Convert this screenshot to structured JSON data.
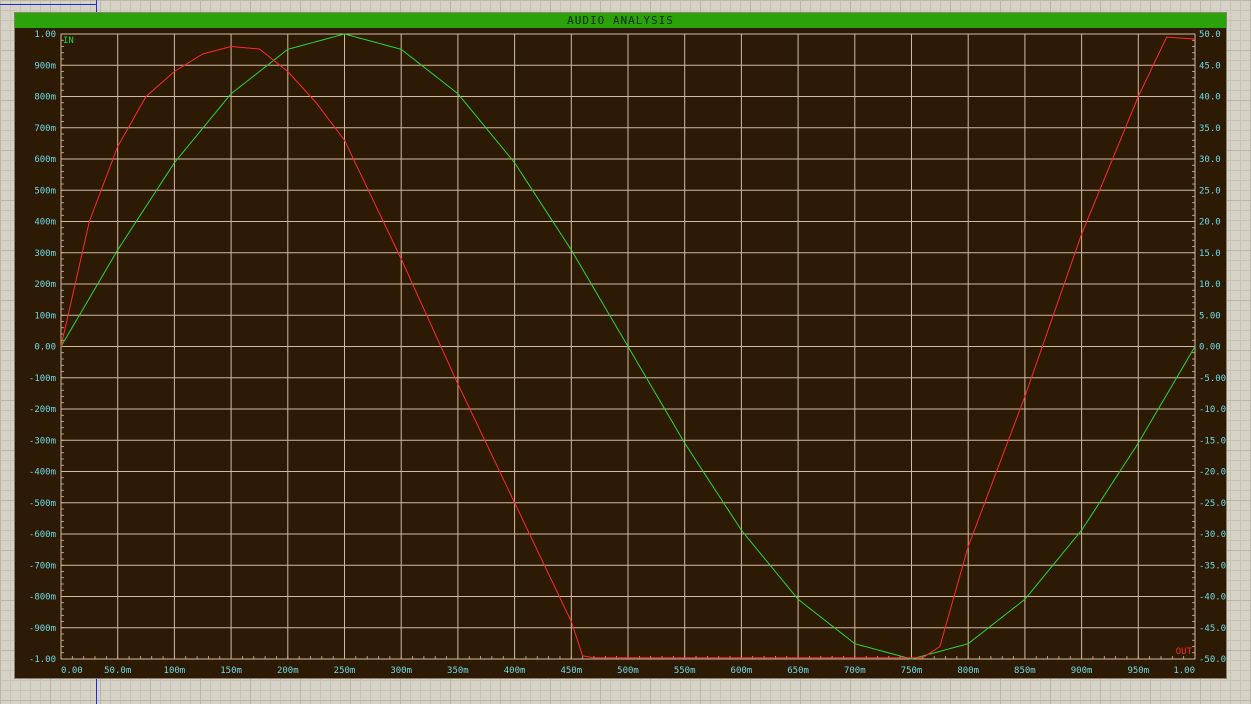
{
  "window": {
    "title": "AUDIO ANALYSIS"
  },
  "colors": {
    "background": "#2d1a04",
    "grid": "#d4b9a2",
    "axis_text": "#6fd9e6",
    "title_bar": "#2aa20a",
    "in_trace": "#2fd62f",
    "out_trace": "#ff2a2a"
  },
  "chart_data": {
    "type": "line",
    "title": "AUDIO ANALYSIS",
    "grid": true,
    "x": [
      0,
      0.05,
      0.1,
      0.15,
      0.2,
      0.25,
      0.3,
      0.35,
      0.4,
      0.45,
      0.5,
      0.55,
      0.6,
      0.65,
      0.7,
      0.75,
      0.8,
      0.85,
      0.9,
      0.95,
      1.0
    ],
    "x_tick_labels": [
      "0.00",
      "50.0m",
      "100m",
      "150m",
      "200m",
      "250m",
      "300m",
      "350m",
      "400m",
      "450m",
      "500m",
      "550m",
      "600m",
      "650m",
      "700m",
      "750m",
      "800m",
      "850m",
      "900m",
      "950m",
      "1.00"
    ],
    "xlim": [
      0,
      1.0
    ],
    "y_left": {
      "range": [
        -1.0,
        1.0
      ],
      "tick_labels": [
        "1.00",
        "900m",
        "800m",
        "700m",
        "600m",
        "500m",
        "400m",
        "300m",
        "200m",
        "100m",
        "0.00",
        "-100m",
        "-200m",
        "-300m",
        "-400m",
        "-500m",
        "-600m",
        "-700m",
        "-800m",
        "-900m",
        "-1.00"
      ]
    },
    "y_right": {
      "range": [
        -50,
        50
      ],
      "tick_labels": [
        "50.0",
        "45.0",
        "40.0",
        "35.0",
        "30.0",
        "25.0",
        "20.0",
        "15.0",
        "10.0",
        "5.00",
        "0.00",
        "-5.00",
        "-10.0",
        "-15.0",
        "-20.0",
        "-25.0",
        "-30.0",
        "-35.0",
        "-40.0",
        "-45.0",
        "-50.0"
      ]
    },
    "series": [
      {
        "name": "IN",
        "axis": "left",
        "points": [
          [
            0,
            0
          ],
          [
            0.05,
            0.309
          ],
          [
            0.1,
            0.588
          ],
          [
            0.15,
            0.809
          ],
          [
            0.2,
            0.951
          ],
          [
            0.25,
            1.0
          ],
          [
            0.3,
            0.951
          ],
          [
            0.35,
            0.809
          ],
          [
            0.4,
            0.588
          ],
          [
            0.45,
            0.309
          ],
          [
            0.5,
            0
          ],
          [
            0.55,
            -0.309
          ],
          [
            0.6,
            -0.588
          ],
          [
            0.65,
            -0.809
          ],
          [
            0.7,
            -0.951
          ],
          [
            0.75,
            -1.0
          ],
          [
            0.8,
            -0.951
          ],
          [
            0.85,
            -0.809
          ],
          [
            0.9,
            -0.588
          ],
          [
            0.95,
            -0.309
          ],
          [
            1.0,
            0
          ]
        ]
      },
      {
        "name": "OUT",
        "axis": "right",
        "points": [
          [
            0,
            0
          ],
          [
            0.025,
            20
          ],
          [
            0.05,
            32
          ],
          [
            0.075,
            40
          ],
          [
            0.1,
            44
          ],
          [
            0.125,
            46.8
          ],
          [
            0.15,
            48
          ],
          [
            0.175,
            47.6
          ],
          [
            0.2,
            44
          ],
          [
            0.225,
            39
          ],
          [
            0.25,
            33
          ],
          [
            0.3,
            14
          ],
          [
            0.35,
            -6
          ],
          [
            0.4,
            -25
          ],
          [
            0.45,
            -44
          ],
          [
            0.46,
            -49.5
          ],
          [
            0.47,
            -49.8
          ],
          [
            0.5,
            -49.8
          ],
          [
            0.75,
            -49.8
          ],
          [
            0.76,
            -49.8
          ],
          [
            0.775,
            -48
          ],
          [
            0.8,
            -32
          ],
          [
            0.85,
            -8
          ],
          [
            0.9,
            18
          ],
          [
            0.95,
            40
          ],
          [
            0.975,
            49.5
          ],
          [
            1.0,
            49.2
          ]
        ]
      }
    ]
  }
}
